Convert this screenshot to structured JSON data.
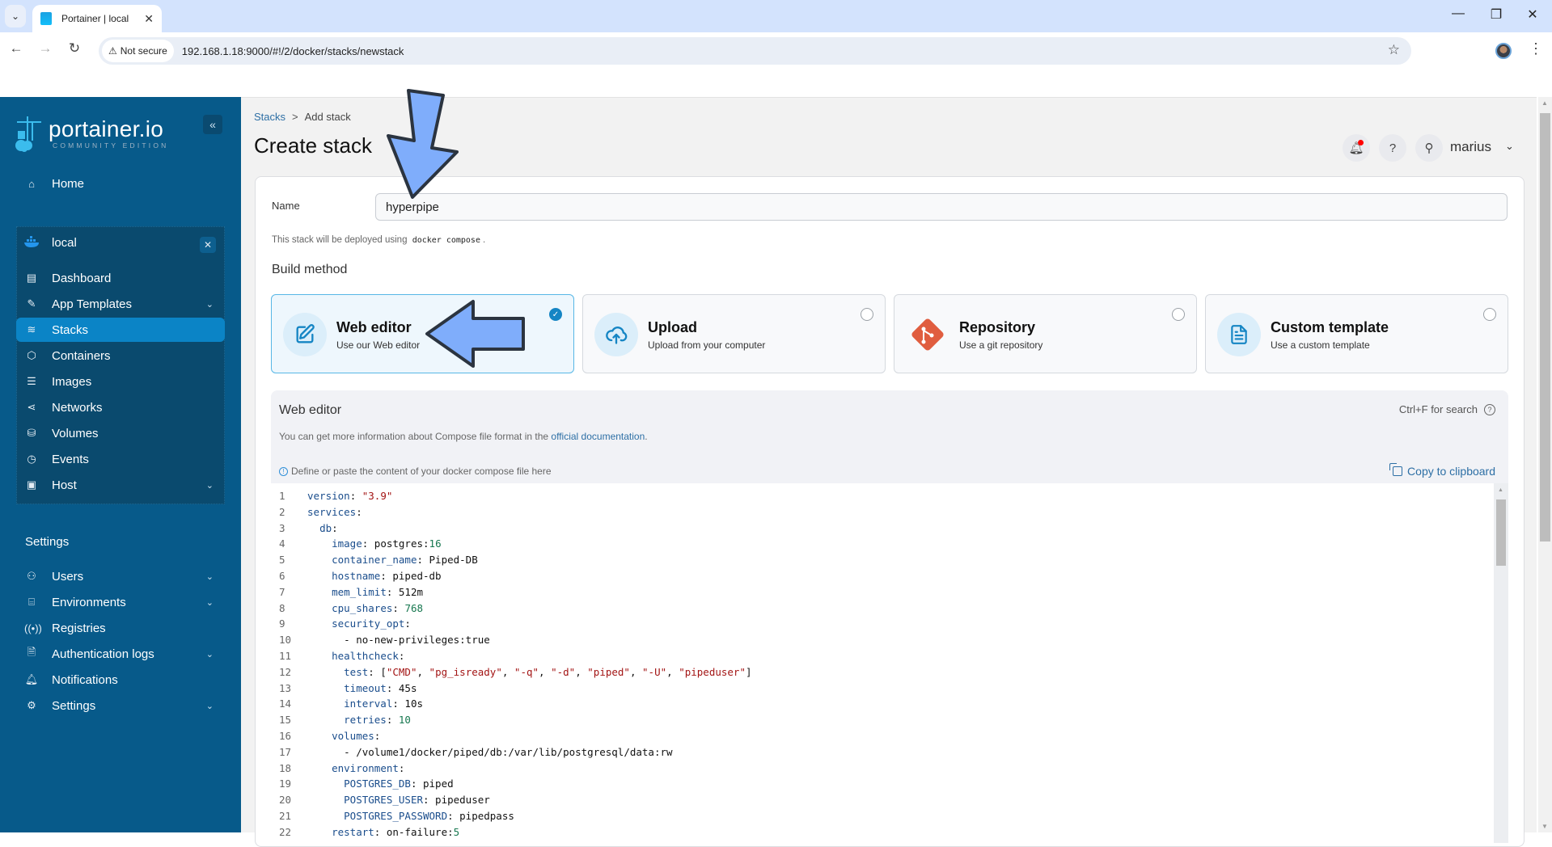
{
  "browser": {
    "tab_title": "Portainer | local",
    "security_label": "Not secure",
    "url": "192.168.1.18:9000/#!/2/docker/stacks/newstack"
  },
  "sidebar": {
    "logo_main": "portainer.io",
    "logo_sub": "COMMUNITY EDITION",
    "home": "Home",
    "environment": {
      "name": "local",
      "items": [
        {
          "label": "Dashboard",
          "icon": "dashboard-icon",
          "expandable": false
        },
        {
          "label": "App Templates",
          "icon": "edit-icon",
          "expandable": true
        },
        {
          "label": "Stacks",
          "icon": "layers-icon",
          "expandable": false,
          "active": true
        },
        {
          "label": "Containers",
          "icon": "box-icon",
          "expandable": false
        },
        {
          "label": "Images",
          "icon": "list-icon",
          "expandable": false
        },
        {
          "label": "Networks",
          "icon": "share-icon",
          "expandable": false
        },
        {
          "label": "Volumes",
          "icon": "database-icon",
          "expandable": false
        },
        {
          "label": "Events",
          "icon": "clock-icon",
          "expandable": false
        },
        {
          "label": "Host",
          "icon": "host-icon",
          "expandable": true
        }
      ]
    },
    "settings_header": "Settings",
    "settings_items": [
      {
        "label": "Users",
        "icon": "users-icon",
        "expandable": true
      },
      {
        "label": "Environments",
        "icon": "hard-drive-icon",
        "expandable": true
      },
      {
        "label": "Registries",
        "icon": "radio-icon",
        "expandable": false
      },
      {
        "label": "Authentication logs",
        "icon": "file-text-icon",
        "expandable": true
      },
      {
        "label": "Notifications",
        "icon": "bell-icon",
        "expandable": false
      },
      {
        "label": "Settings",
        "icon": "gear-icon",
        "expandable": true
      }
    ]
  },
  "header": {
    "breadcrumb": [
      "Stacks",
      "Add stack"
    ],
    "title": "Create stack",
    "username": "marius"
  },
  "form": {
    "name_label": "Name",
    "name_value": "hyperpipe",
    "deploy_note_prefix": "This stack will be deployed using",
    "deploy_note_code": "docker compose",
    "deploy_note_suffix": ".",
    "build_method_header": "Build method",
    "build_methods": [
      {
        "title": "Web editor",
        "subtitle": "Use our Web editor",
        "selected": true
      },
      {
        "title": "Upload",
        "subtitle": "Upload from your computer",
        "selected": false
      },
      {
        "title": "Repository",
        "subtitle": "Use a git repository",
        "selected": false
      },
      {
        "title": "Custom template",
        "subtitle": "Use a custom template",
        "selected": false
      }
    ]
  },
  "editor": {
    "title": "Web editor",
    "search_hint": "Ctrl+F for search",
    "info_prefix": "You can get more information about Compose file format in the",
    "info_link": "official documentation",
    "info_suffix": ".",
    "hint": "Define or paste the content of your docker compose file here",
    "copy_label": "Copy to clipboard",
    "lines": [
      "version: \"3.9\"",
      "services:",
      "  db:",
      "    image: postgres:16",
      "    container_name: Piped-DB",
      "    hostname: piped-db",
      "    mem_limit: 512m",
      "    cpu_shares: 768",
      "    security_opt:",
      "      - no-new-privileges:true",
      "    healthcheck:",
      "      test: [\"CMD\", \"pg_isready\", \"-q\", \"-d\", \"piped\", \"-U\", \"pipeduser\"]",
      "      timeout: 45s",
      "      interval: 10s",
      "      retries: 10",
      "    volumes:",
      "      - /volume1/docker/piped/db:/var/lib/postgresql/data:rw",
      "    environment:",
      "      POSTGRES_DB: piped",
      "      POSTGRES_USER: pipeduser",
      "      POSTGRES_PASSWORD: pipedpass",
      "    restart: on-failure:5"
    ]
  },
  "colors": {
    "sidebar_bg": "#075a8a",
    "sidebar_active": "#0b84c6",
    "accent_link": "#2d6fa5",
    "annotation_arrow": "#7fadfb"
  }
}
